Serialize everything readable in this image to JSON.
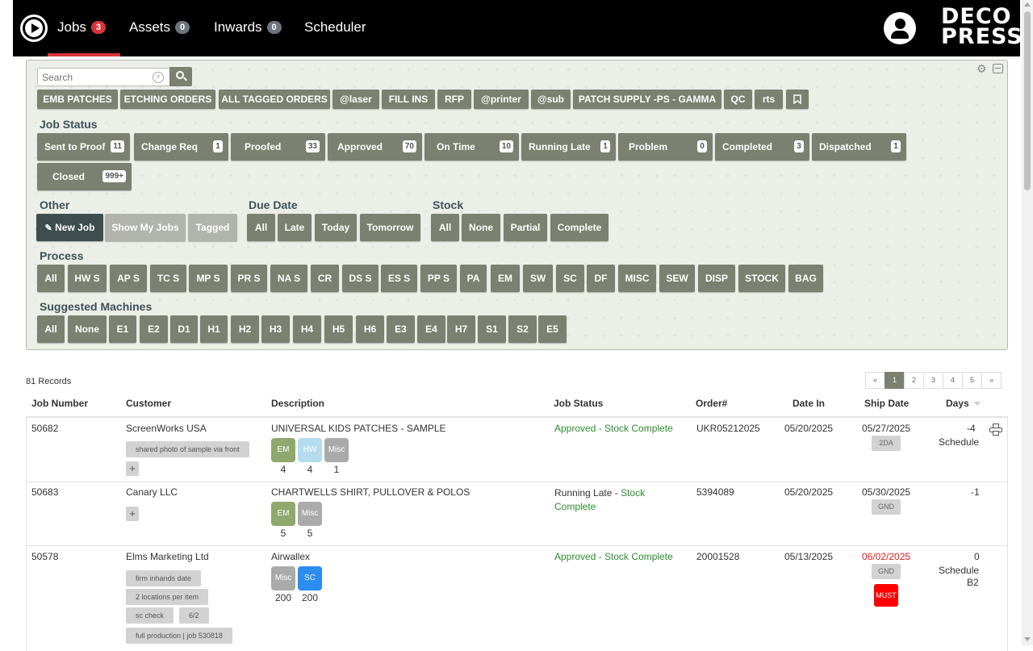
{
  "nav": {
    "items": [
      {
        "label": "Jobs",
        "badge": "3",
        "badge_color": "#d9343b"
      },
      {
        "label": "Assets",
        "badge": "0",
        "badge_color": "#6c757d"
      },
      {
        "label": "Inwards",
        "badge": "0",
        "badge_color": "#6c757d"
      },
      {
        "label": "Scheduler"
      }
    ],
    "brand_line1": "DECO",
    "brand_line2": "PRESS"
  },
  "search": {
    "placeholder": "Search",
    "value": ""
  },
  "saved_filters": [
    "EMB PATCHES",
    "ETCHING ORDERS",
    "ALL TAGGED ORDERS",
    "@laser",
    "FILL INS",
    "RFP",
    "@printer",
    "@sub",
    "PATCH SUPPLY -PS - GAMMA",
    "QC",
    "rts"
  ],
  "job_status": {
    "label": "Job Status",
    "items": [
      {
        "label": "Sent to Proof",
        "count": "11"
      },
      {
        "label": "Change Req",
        "count": "1"
      },
      {
        "label": "Proofed",
        "count": "33"
      },
      {
        "label": "Approved",
        "count": "70"
      },
      {
        "label": "On Time",
        "count": "10"
      },
      {
        "label": "Running Late",
        "count": "1"
      },
      {
        "label": "Problem",
        "count": "0"
      },
      {
        "label": "Completed",
        "count": "3"
      },
      {
        "label": "Dispatched",
        "count": "1"
      },
      {
        "label": "Closed",
        "count": "999+"
      }
    ]
  },
  "other": {
    "label": "Other",
    "new_job": "New Job",
    "show_my_jobs": "Show My Jobs",
    "tagged": "Tagged"
  },
  "due_date": {
    "label": "Due Date",
    "items": [
      "All",
      "Late",
      "Today",
      "Tomorrow"
    ]
  },
  "stock": {
    "label": "Stock",
    "items": [
      "All",
      "None",
      "Partial",
      "Complete"
    ]
  },
  "process": {
    "label": "Process",
    "items": [
      "All",
      "HW S",
      "AP S",
      "TC S",
      "MP S",
      "PR S",
      "NA S",
      "CR",
      "DS S",
      "ES S",
      "PP S",
      "PA",
      "EM",
      "SW",
      "SC",
      "DF",
      "MISC",
      "SEW",
      "DISP",
      "STOCK",
      "BAG"
    ]
  },
  "machines": {
    "label": "Suggested Machines",
    "items": [
      "All",
      "None",
      "E1",
      "E2",
      "D1",
      "H1",
      "H2",
      "H3",
      "H4",
      "H5",
      "H6",
      "E3",
      "E4",
      "H7",
      "S1",
      "S2",
      "E5"
    ]
  },
  "records_label": "81 Records",
  "pager": [
    "«",
    "1",
    "2",
    "3",
    "4",
    "5",
    "»"
  ],
  "table": {
    "headers": [
      "Job Number",
      "Customer",
      "Description",
      "Job Status",
      "Order#",
      "Date In",
      "Ship Date",
      "Days"
    ],
    "rows": [
      {
        "job": "50682",
        "customer": "ScreenWorks USA",
        "tags": [
          "shared photo of sample via front"
        ],
        "plus": "+",
        "description": "UNIVERSAL KIDS PATCHES - SAMPLE",
        "procs": [
          {
            "name": "EM",
            "count": "4",
            "color": "#8fa86b"
          },
          {
            "name": "HW",
            "count": "4",
            "color": "#b4dcee"
          },
          {
            "name": "Misc",
            "count": "1",
            "color": "#aaaaaa"
          }
        ],
        "status": "Approved - Stock Complete",
        "order": "UKR05212025",
        "date_in": "05/20/2025",
        "ship_date": "05/27/2025",
        "ship_method": "2DA",
        "days": "-4",
        "schedule": "Schedule"
      },
      {
        "job": "50683",
        "customer": "Canary LLC",
        "plus": "+",
        "description": "CHARTWELLS SHIRT, PULLOVER & POLOS",
        "procs": [
          {
            "name": "EM",
            "count": "5",
            "color": "#8fa86b"
          },
          {
            "name": "Misc",
            "count": "5",
            "color": "#aaaaaa"
          }
        ],
        "status_part1": "Running Late - ",
        "status_part2": "Stock",
        "status_part3": "Complete",
        "order": "5394089",
        "date_in": "05/20/2025",
        "ship_date": "05/30/2025",
        "ship_method": "GND",
        "days": "-1"
      },
      {
        "job": "50578",
        "customer": "Elms Marketing Ltd",
        "tags": [
          "firm inhands date",
          "2 locations per item",
          "sc check",
          "6/2",
          "full production | job 530818"
        ],
        "description": "Airwallex",
        "procs": [
          {
            "name": "Misc",
            "count": "200",
            "color": "#aaaaaa"
          },
          {
            "name": "SC",
            "count": "200",
            "color": "#2d8cf0"
          }
        ],
        "status": "Approved - Stock Complete",
        "order": "20001528",
        "date_in": "05/13/2025",
        "ship_date": "06/02/2025",
        "ship_method": "GND",
        "must": "MUST",
        "days": "0",
        "schedule": "Schedule",
        "schedule_sub": "B2"
      }
    ]
  }
}
